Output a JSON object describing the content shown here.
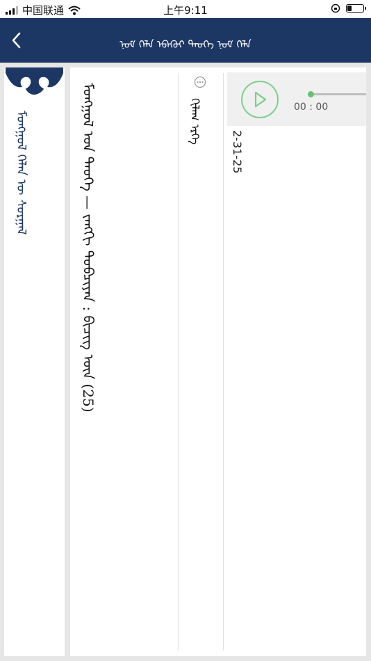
{
  "status_bar": {
    "carrier": "中国联通",
    "time": "上午9:11"
  },
  "header": {
    "title": "ᠨᠤᠮ ᠬᠡᠯᠡ ᠡᠪᠡᠬᠦᠢ ᠲᠡᠦᠬᠡ ᠨᠤᠮ ᠬᠡᠯᠡ"
  },
  "side_menu": {
    "label": "ᠮᠣᠩᠭᠣᠯ ᠬᠡᠯᠡᠨ ᠦ ᠰᠤᠷᠭᠠᠯ"
  },
  "article": {
    "title": "ᠮᠣᠩᠭᠣᠯ ᠤᠨ ᠲᠡᠦᠬᠡ — ᠵᠠᠩᠭᠢ ᠲᠣᠪᠴᠢᠶᠠᠨ : ᠪᠢᠴᠢᠭ ᠦᠨ (25)",
    "author": "ᠬᠢᠯᠠᠭ ᠡᠷᠬᠡ",
    "date": "2-31-25",
    "more_icon": "more-dots-icon"
  },
  "player": {
    "time": "00 : 00",
    "progress": 0
  },
  "colors": {
    "header_bg": "#1c3764",
    "accent_green": "#7ccf8a"
  }
}
